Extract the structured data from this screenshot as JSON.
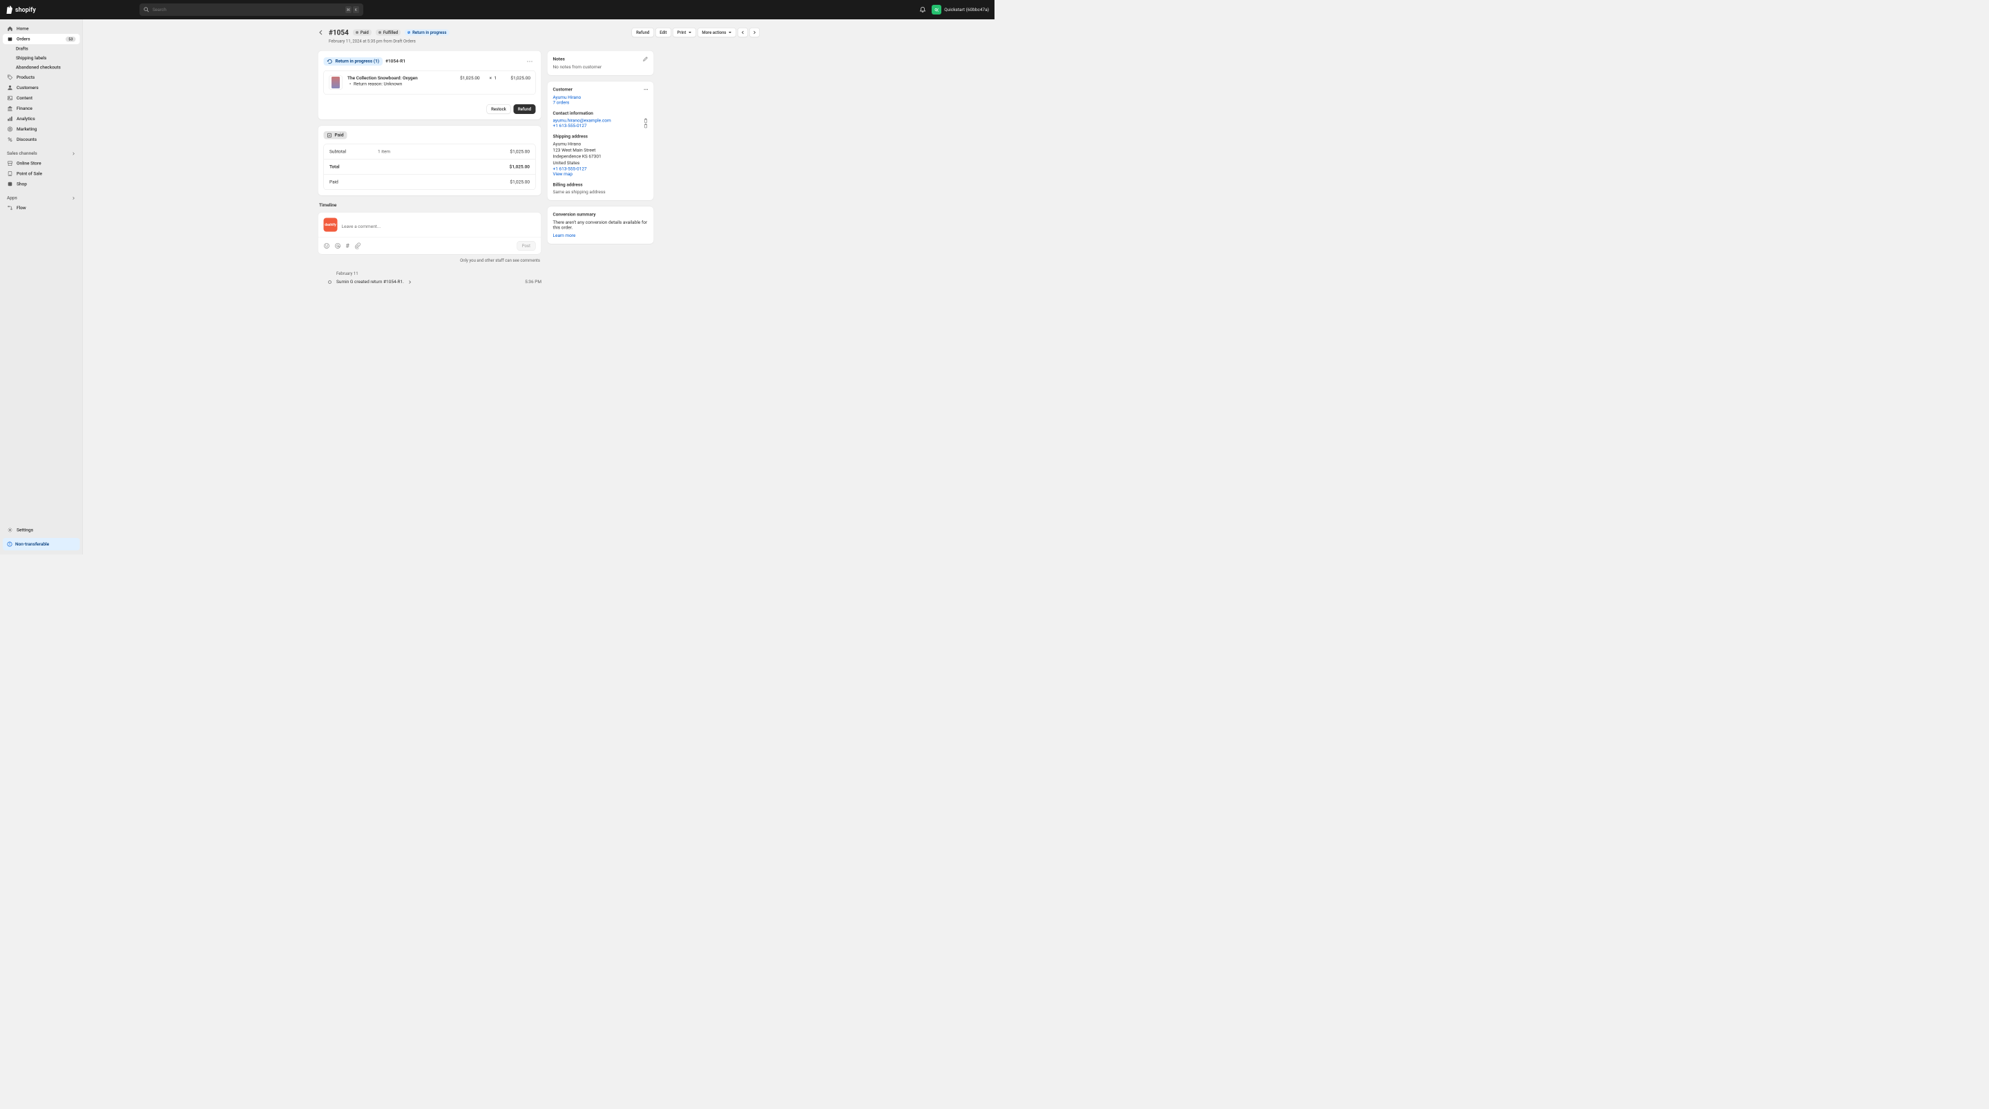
{
  "topbar": {
    "logo_text": "shopify",
    "search_placeholder": "Search",
    "shortcut_cmd": "⌘",
    "shortcut_k": "K",
    "user_avatar": "Q(",
    "user_label": "Quickstart (60bbc47a)"
  },
  "sidebar": {
    "home": "Home",
    "orders": "Orders",
    "orders_badge": "53",
    "drafts": "Drafts",
    "shipping_labels": "Shipping labels",
    "abandoned": "Abandoned checkouts",
    "products": "Products",
    "customers": "Customers",
    "content": "Content",
    "finance": "Finance",
    "analytics": "Analytics",
    "marketing": "Marketing",
    "discounts": "Discounts",
    "sales_channels": "Sales channels",
    "online_store": "Online Store",
    "pos": "Point of Sale",
    "shop": "Shop",
    "apps": "Apps",
    "flow": "Flow",
    "settings": "Settings",
    "non_transferable": "Non-transferable"
  },
  "order": {
    "title": "#1054",
    "badge_paid": "Paid",
    "badge_fulfilled": "Fulfilled",
    "badge_return": "Return in progress",
    "subtitle": "February 11, 2024 at 5:35 pm from Draft Orders",
    "actions": {
      "refund": "Refund",
      "edit": "Edit",
      "print": "Print",
      "more": "More actions"
    }
  },
  "return_card": {
    "pill": "Return in progress (1)",
    "ref": "#1054-R1",
    "item_name": "The Collection Snowboard: Oxygen",
    "item_reason": "Return reason: Unknown",
    "item_price": "$1,025.00",
    "item_qty_sep": "×",
    "item_qty": "1",
    "item_total": "$1,025.00",
    "restock": "Restock",
    "refund": "Refund"
  },
  "paid_card": {
    "pill": "Paid",
    "subtotal_label": "Subtotal",
    "subtotal_items": "1 item",
    "subtotal_val": "$1,025.00",
    "total_label": "Total",
    "total_val": "$1,025.00",
    "paid_label": "Paid",
    "paid_val": "$1,025.00"
  },
  "timeline": {
    "title": "Timeline",
    "comment_placeholder": "Leave a comment...",
    "post": "Post",
    "visibility": "Only you and other staff can see comments",
    "date": "February 11",
    "event_text": "Sumin G created return #1054-R1.",
    "event_time": "5:36 PM",
    "avatar_text": "dashify"
  },
  "notes": {
    "title": "Notes",
    "body": "No notes from customer"
  },
  "customer": {
    "title": "Customer",
    "name": "Ayumu Hirano",
    "orders": "7 orders",
    "contact_title": "Contact information",
    "email": "ayumu.hirano@example.com",
    "phone": "+1 613-555-0127",
    "shipping_title": "Shipping address",
    "addr_name": "Ayumu Hirano",
    "addr_line1": "123 West Main Street",
    "addr_line2": "Independence KS 67301",
    "addr_country": "United States",
    "addr_phone": "+1 613-555-0127",
    "view_map": "View map",
    "billing_title": "Billing address",
    "billing_body": "Same as shipping address"
  },
  "conversion": {
    "title": "Conversion summary",
    "body": "There aren't any conversion details available for this order.",
    "learn_more": "Learn more"
  }
}
